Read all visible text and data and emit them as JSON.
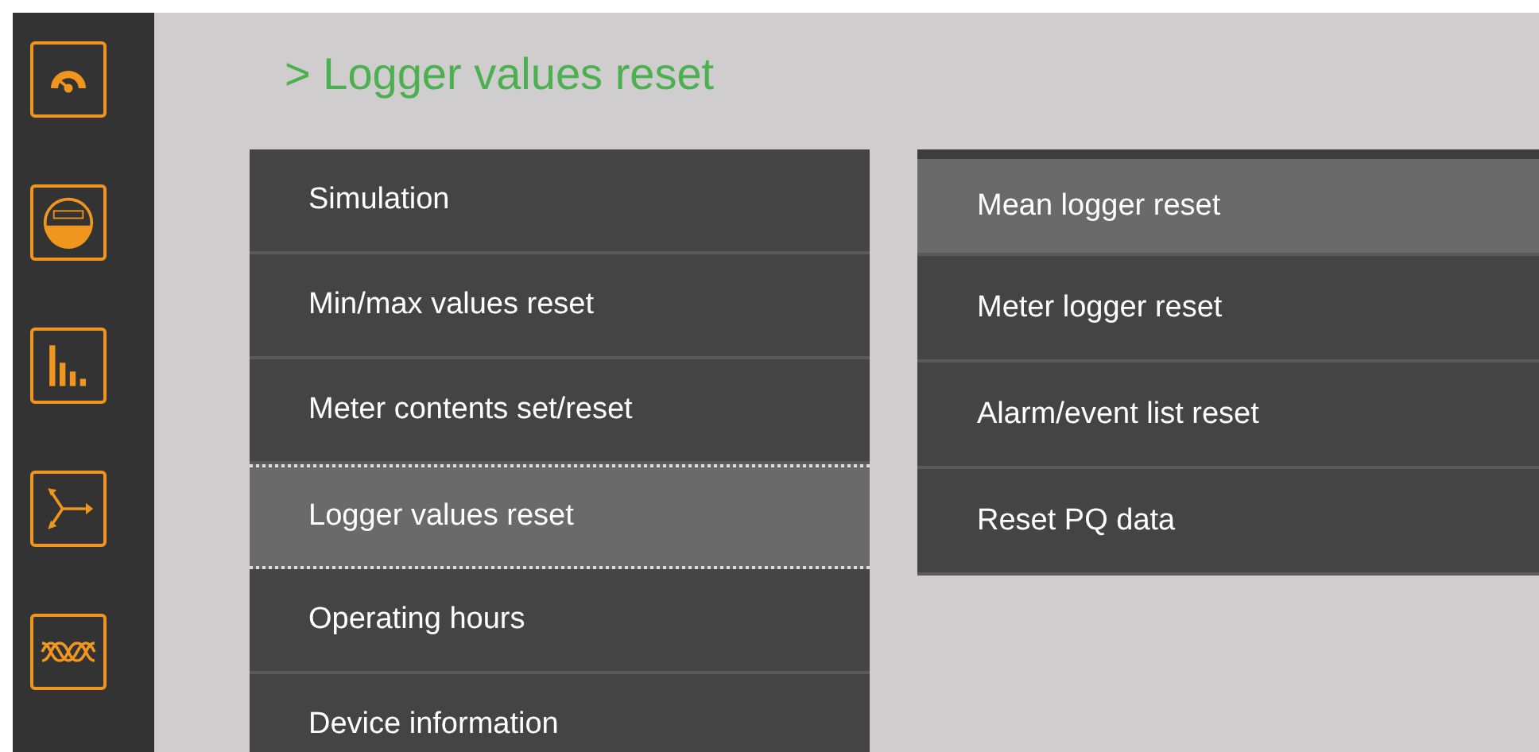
{
  "sidebar": {
    "icons": [
      {
        "kind": "gauge",
        "selected": false
      },
      {
        "kind": "meter",
        "selected": false
      },
      {
        "kind": "bars",
        "selected": false
      },
      {
        "kind": "phasor",
        "selected": false
      },
      {
        "kind": "waves",
        "selected": false
      }
    ]
  },
  "title": "> Logger values reset",
  "menu": [
    {
      "label": "Simulation",
      "selected": false
    },
    {
      "label": "Min/max values reset",
      "selected": false
    },
    {
      "label": "Meter contents set/reset",
      "selected": false
    },
    {
      "label": "Logger values reset",
      "selected": true
    },
    {
      "label": "Operating hours",
      "selected": false
    },
    {
      "label": "Device information",
      "selected": false
    }
  ],
  "submenu": [
    {
      "label": "Mean logger reset",
      "selected": true
    },
    {
      "label": "Meter logger reset",
      "selected": false
    },
    {
      "label": "Alarm/event list reset",
      "selected": false
    },
    {
      "label": "Reset PQ data",
      "selected": false
    }
  ]
}
